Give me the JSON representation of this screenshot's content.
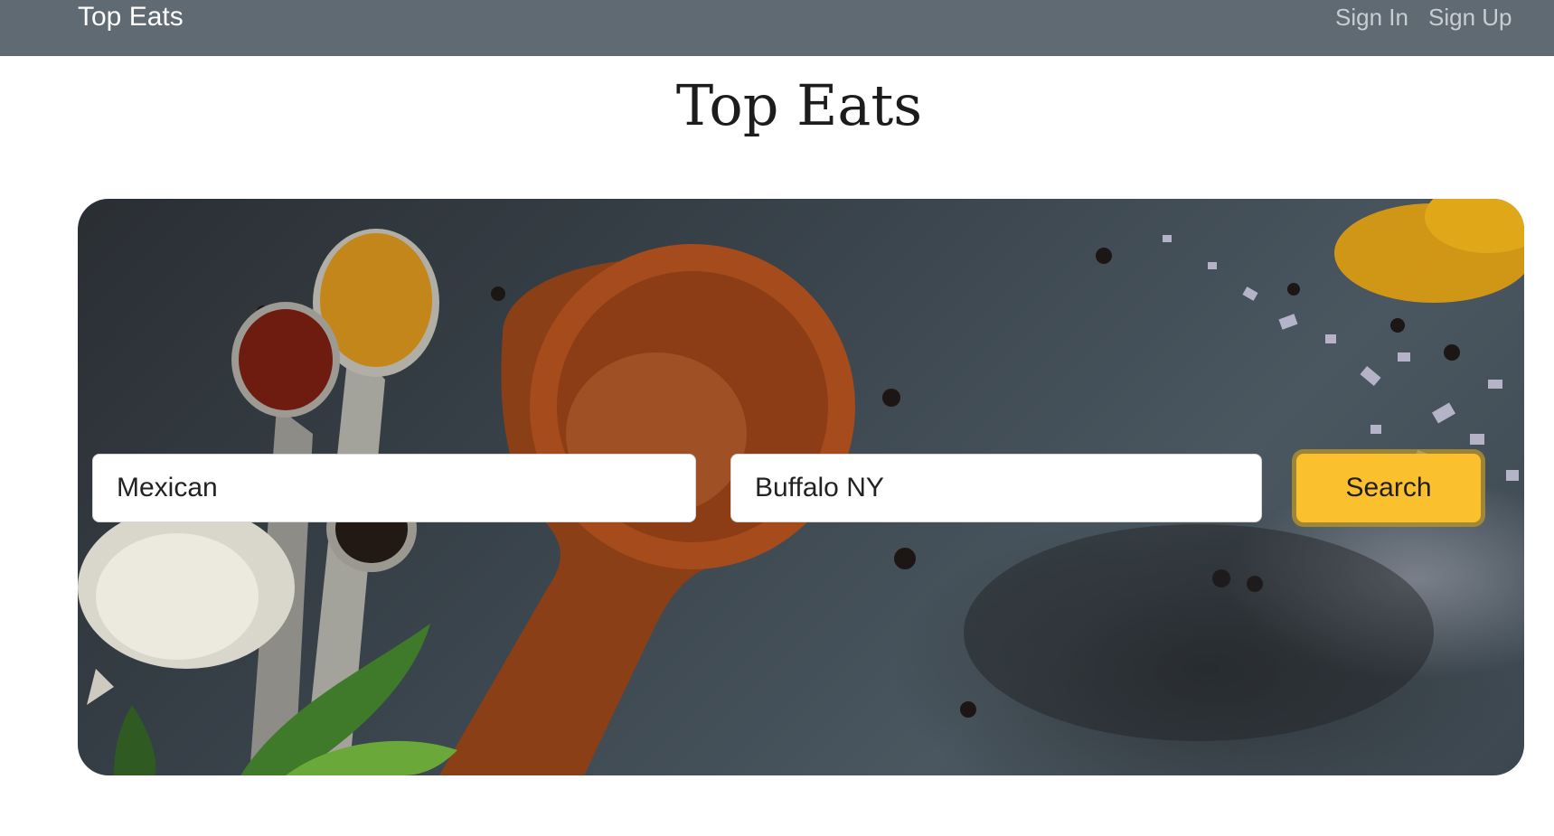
{
  "navbar": {
    "brand": "Top Eats",
    "links": [
      {
        "label": "Sign In"
      },
      {
        "label": "Sign Up"
      }
    ]
  },
  "page": {
    "title": "Top Eats"
  },
  "search": {
    "term_value": "Mexican",
    "location_value": "Buffalo NY",
    "button_label": "Search"
  },
  "colors": {
    "navbar_bg": "#606a73",
    "search_button": "#fbc02d"
  }
}
